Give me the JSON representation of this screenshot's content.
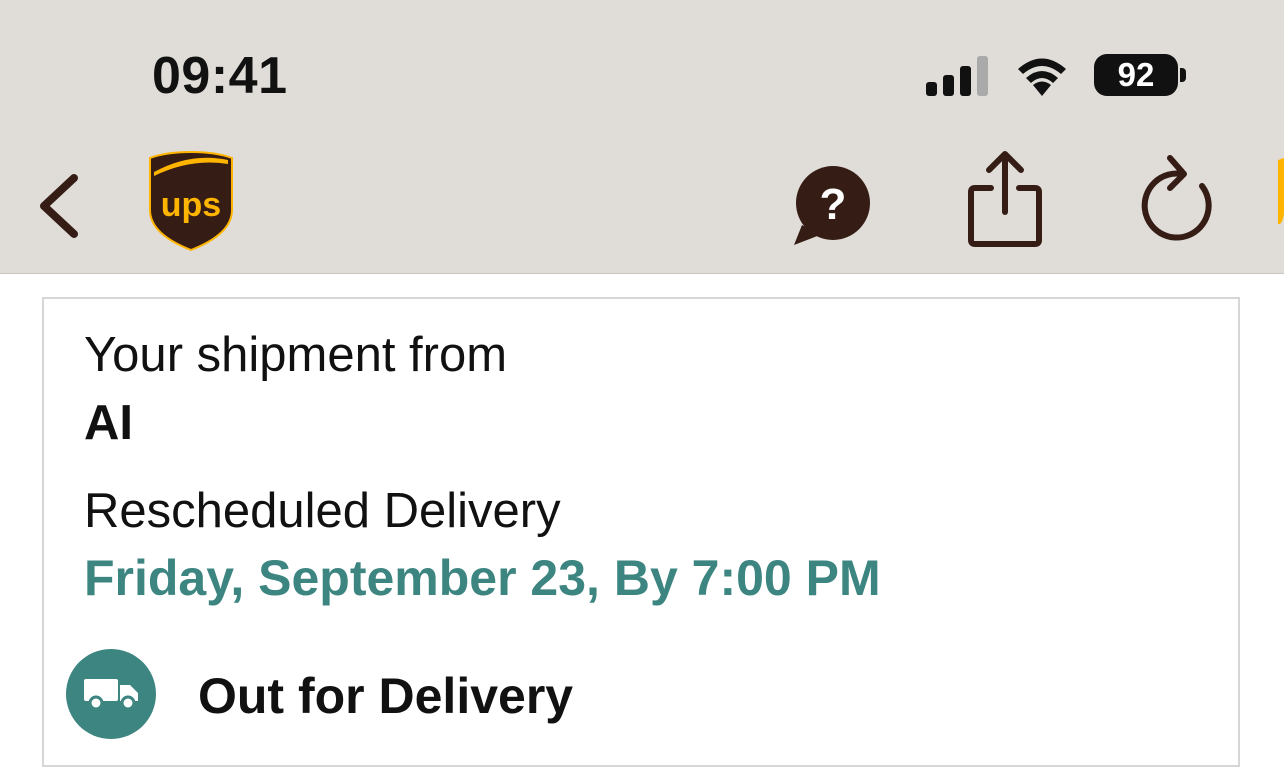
{
  "status_bar": {
    "time": "09:41",
    "battery": "92"
  },
  "nav": {
    "icons": [
      "back-chevron-icon",
      "ups-logo",
      "help-chat-icon",
      "share-icon",
      "refresh-icon"
    ]
  },
  "shipment": {
    "from_label": "Your shipment from",
    "sender": "AI",
    "delivery_label": "Rescheduled Delivery",
    "delivery_date": "Friday, September 23, By 7:00 PM",
    "status": "Out for Delivery"
  },
  "colors": {
    "toolbar_bg": "#e0ddd8",
    "accent_teal": "#3c8580",
    "ups_brown": "#351c15",
    "ups_gold": "#ffb500"
  }
}
